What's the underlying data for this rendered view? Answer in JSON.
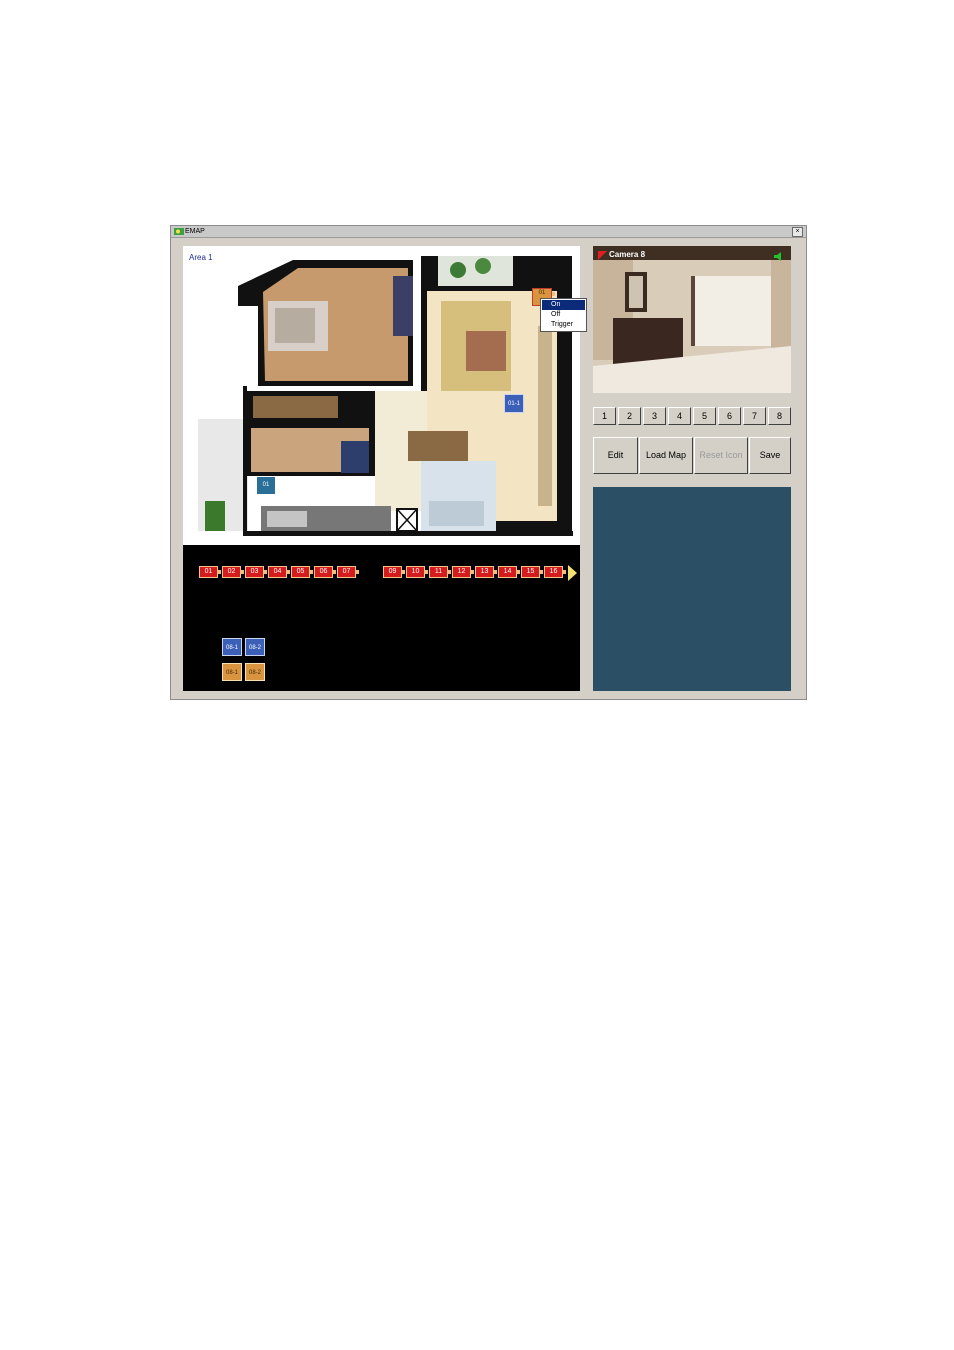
{
  "window": {
    "title": "EMAP",
    "close_label": "×"
  },
  "map": {
    "area_label": "Area 1"
  },
  "context_menu": {
    "items": [
      "On",
      "Off",
      "Trigger"
    ],
    "selected": "On"
  },
  "map_icons": {
    "camera_icon_label": "01",
    "sensor_icon_label": "01-1",
    "relay_icon_label": "01"
  },
  "tray": {
    "camera_icons": [
      "01",
      "02",
      "03",
      "04",
      "05",
      "06",
      "07",
      "09",
      "10",
      "11",
      "12",
      "13",
      "14",
      "15",
      "16"
    ],
    "sensor_icons": [
      "08-1",
      "08-2"
    ],
    "relay_icons": [
      "08-1",
      "08-2"
    ]
  },
  "camera_view": {
    "label": "Camera 8"
  },
  "camera_buttons": [
    "1",
    "2",
    "3",
    "4",
    "5",
    "6",
    "7",
    "8"
  ],
  "actions": {
    "edit": "Edit",
    "load_map": "Load Map",
    "reset_icon": "Reset Icon",
    "save": "Save"
  },
  "colors": {
    "title_bar": "#c9c9c9",
    "window_bg": "#d4d0c8",
    "tray_bg": "#000000",
    "info_panel": "#2b5065",
    "camera_icon": "#d41c1c",
    "sensor_icon": "#3c5fb8",
    "relay_icon": "#d99440"
  }
}
